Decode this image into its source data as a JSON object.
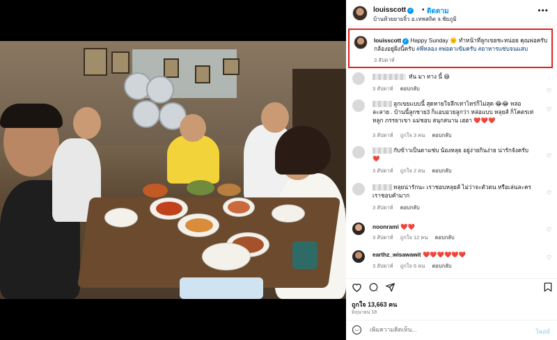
{
  "post": {
    "username": "louisscott",
    "follow_label": "ติดตาม",
    "location": "บ้านห้วยยายจิ๋ว อ.เทพสถิต จ.ชัยภูมิ",
    "more_icon": "more-icon"
  },
  "caption": {
    "username": "louisscott",
    "text": "Happy Sunday 🌞 ทำหน้าที่ลูกเขยชะหน่อย คุณพ่อครับกล้องอยู่ฝั่งนี้ครับ ",
    "hashtags": "#พี่หลอง #พ่อตาเข้มครับ #อาหารแซ่บจนแสบ",
    "time": "3 สัปดาห์"
  },
  "comments": [
    {
      "username": "",
      "text": "หัน มา ทาง นี้ 😄",
      "time": "3 สัปดาห์",
      "likes": "",
      "reply": "ตอบกลับ"
    },
    {
      "username": "",
      "text": "ลูกเขยแบบนี้ สุดหายใจลึกเท่าไหร่ก็ไม่สุด 😂😂 หล่อละลาย . บ้านนี้ลูกชาย3 ก็แอบอวยลูกว่า หล่อแบบ หลุยส์ ก็โคตรเท่หลูก ภรรยาเขา แม่ชอบ สนุกสนาน เฮฮา ❤️❤️❤️",
      "time": "3 สัปดาห์",
      "likes": "ถูกใจ 3 คน",
      "reply": "ตอบกลับ"
    },
    {
      "username": "",
      "text": "กับข้าวเป็นดาแซ่บ น้องหลุย อยู่ง่ายกินง่าย น่ารักจังครับ ❤️",
      "time": "3 สัปดาห์",
      "likes": "ถูกใจ 2 คน",
      "reply": "ตอบกลับ"
    },
    {
      "username": "",
      "text": "หลุยน่ารักนะ เราชอบหลุยส์ ไม่ว่าจะตัวตน หรือเล่นละคร เราชอบคำมาก",
      "time": "3 สัปดาห์",
      "likes": "",
      "reply": "ตอบกลับ"
    },
    {
      "username": "noonrami",
      "text": "❤️❤️",
      "time": "3 สัปดาห์",
      "likes": "ถูกใจ 12 คน",
      "reply": "ตอบกลับ"
    },
    {
      "username": "earthz_wisawawit",
      "text": "❤️❤️❤️❤️❤️❤️",
      "time": "3 สัปดาห์",
      "likes": "ถูกใจ 6 คน",
      "reply": "ตอบกลับ"
    }
  ],
  "actions": {
    "like_icon": "heart-icon",
    "comment_icon": "comment-icon",
    "share_icon": "share-icon",
    "save_icon": "bookmark-icon"
  },
  "likes_text": "ถูกใจ 13,663 คน",
  "date_text": "มิถุนายน 18",
  "add_comment": {
    "placeholder": "เพิ่มความคิดเห็น...",
    "post_label": "โพสต์"
  },
  "colors": {
    "accent": "#0095f6",
    "highlight_border": "#e02020",
    "heart": "#ed1c3c"
  }
}
